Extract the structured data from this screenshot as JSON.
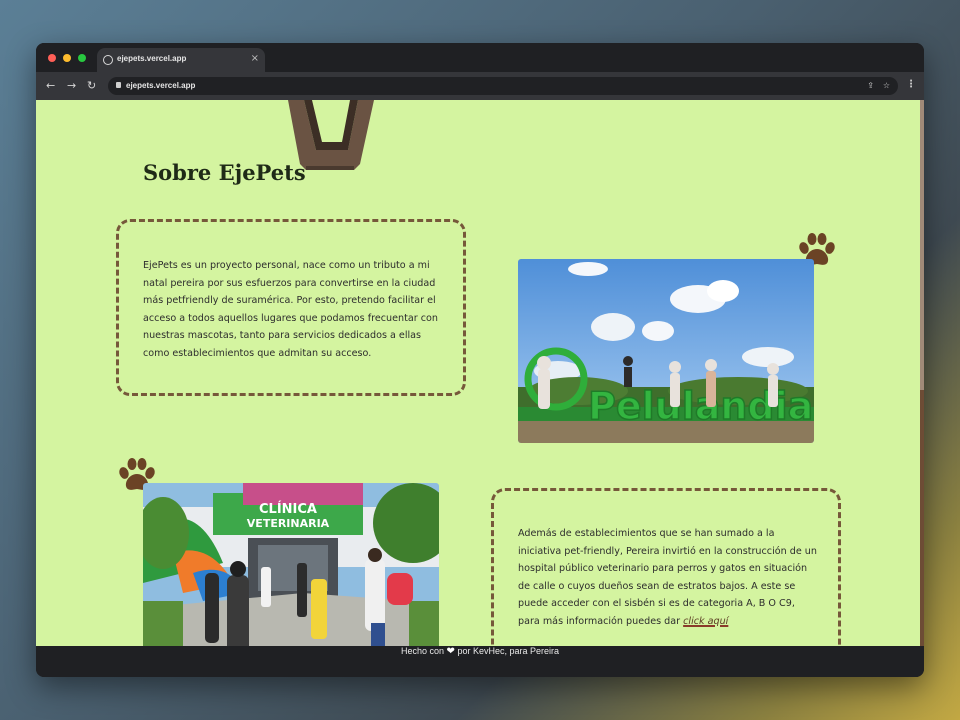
{
  "browser": {
    "tab_title": "ejepets.vercel.app",
    "tab_close": "×",
    "url": "ejepets.vercel.app",
    "nav": {
      "back": "←",
      "forward": "→",
      "reload": "↻"
    },
    "share_glyph": "⇪",
    "bookmark_glyph": "☆",
    "menu_glyph": "⋮"
  },
  "page": {
    "title": "Sobre EjePets",
    "section1": {
      "text": "EjePets es un proyecto personal, nace como un tributo a mi natal pereira por sus esfuerzos para convertirse en la ciudad más petfriendly de suramérica. Por esto, pretendo facilitar el acceso a todos aquellos lugares que podamos frecuentar con nuestras mascotas, tanto para servicios dedicados a ellas como establecimientos que admitan su acceso.",
      "photo_sign": "Pelulandia"
    },
    "section2": {
      "text_before_link": "Además de establecimientos que se han sumado a la iniciativa pet-friendly, Pereira invirtió en la construcción de un hospital público veterinario para perros y gatos en situación de calle o cuyos dueños sean de estratos bajos. A este se puede acceder con el sisbén si es de categoria A, B O C9, para más información puedes dar ",
      "link_text": "click aquí",
      "photo_sign_line1": "CLÍNICA",
      "photo_sign_line2": "VETERINARIA"
    }
  },
  "footer": {
    "before_heart": "Hecho con",
    "heart": "❤",
    "after_heart": "por KevHec, para Pereira"
  },
  "colors": {
    "page_bg": "#d4f4a0",
    "accent_brown": "#76583a",
    "title": "#1f2a17",
    "browser_chrome": "#1f2023"
  }
}
